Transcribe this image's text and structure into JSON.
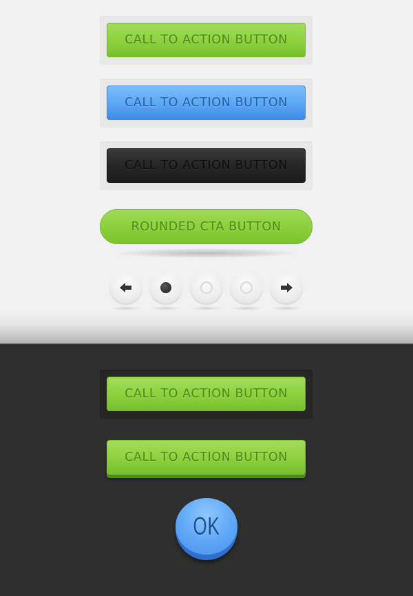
{
  "light_section": {
    "buttons": [
      {
        "label": "CALL TO ACTION BUTTON",
        "style": "green",
        "color": "#8dd03d"
      },
      {
        "label": "CALL TO ACTION BUTTON",
        "style": "blue",
        "color": "#5aa6f4"
      },
      {
        "label": "CALL TO ACTION BUTTON",
        "style": "black",
        "color": "#262626"
      }
    ],
    "rounded_button": {
      "label": "ROUNDED CTA BUTTON",
      "color": "#8ccf3c"
    },
    "pagination": {
      "prev_icon": "arrow-left-icon",
      "next_icon": "arrow-right-icon",
      "dots": [
        {
          "state": "active"
        },
        {
          "state": "inactive"
        },
        {
          "state": "inactive"
        }
      ]
    }
  },
  "dark_section": {
    "buttons": [
      {
        "label": "CALL TO ACTION BUTTON",
        "style": "green-inset",
        "color": "#8dd03d"
      },
      {
        "label": "CALL TO ACTION BUTTON",
        "style": "green-raised",
        "color": "#8dd03d"
      }
    ],
    "ok_button": {
      "label": "OK",
      "color": "#5ea6f6"
    }
  }
}
